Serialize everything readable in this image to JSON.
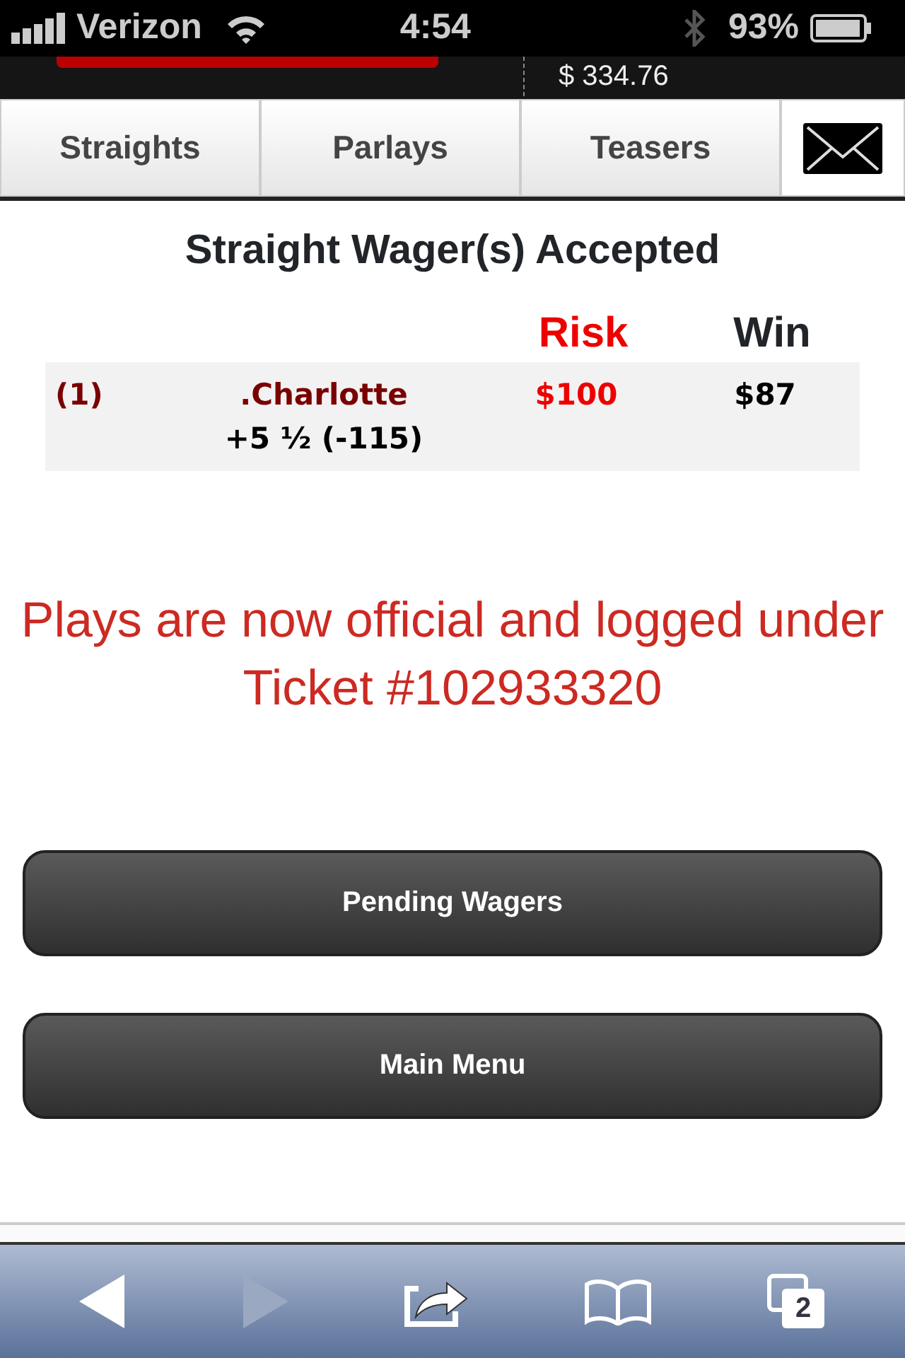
{
  "status_bar": {
    "carrier": "Verizon",
    "time": "4:54",
    "battery": "93%"
  },
  "header": {
    "balance": "$ 334.76"
  },
  "tabs": [
    {
      "label": "Straights",
      "kind": "text"
    },
    {
      "label": "Parlays",
      "kind": "text"
    },
    {
      "label": "Teasers",
      "kind": "text"
    },
    {
      "kind": "mail"
    }
  ],
  "title": "Straight Wager(s) Accepted",
  "table": {
    "columns": [
      "Risk",
      "Win"
    ],
    "rows": [
      {
        "number": "(1)",
        "team": ".Charlotte",
        "line": "+5 ½ (-115)",
        "risk": "$100",
        "win": "$87"
      }
    ]
  },
  "message": "Plays are now official and logged under Ticket #102933320",
  "buttons": [
    "Pending Wagers",
    "Main Menu"
  ],
  "toolbar": {
    "back_disabled": false,
    "forward_disabled": true,
    "tab_count": "2"
  }
}
